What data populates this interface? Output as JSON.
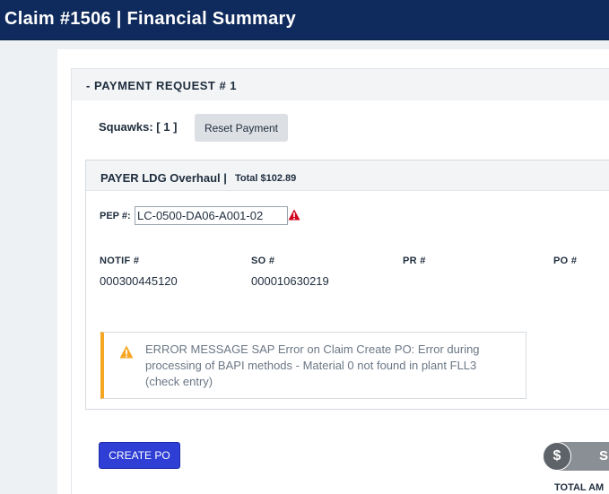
{
  "header": {
    "title": "Claim #1506 | Financial Summary"
  },
  "payment_request": {
    "collapse_symbol": "-",
    "title": "PAYMENT REQUEST # 1",
    "squawks_label": "Squawks: [ 1 ]",
    "reset_button": "Reset Payment"
  },
  "payer": {
    "name": "PAYER LDG Overhaul |",
    "total": "Total $102.89",
    "pep_label": "PEP #:",
    "pep_value": "LC-0500-DA06-A001-02",
    "columns": [
      {
        "label": "NOTIF #",
        "value": "000300445120"
      },
      {
        "label": "SO #",
        "value": "000010630219"
      },
      {
        "label": "PR #",
        "value": ""
      },
      {
        "label": "PO #",
        "value": ""
      }
    ],
    "error_message": "ERROR MESSAGE SAP Error on Claim Create PO: Error during processing of BAPI methods - Material 0 not found in plant FLL3 (check entry)"
  },
  "actions": {
    "create_po": "CREATE PO",
    "status_symbol": "$",
    "status_letter": "S",
    "total_amount_label": "TOTAL AM"
  },
  "colors": {
    "topbar": "#0f2a5c",
    "create_po": "#2f3fd6",
    "warning_orange": "#f5a623",
    "error_red": "#d0021b"
  },
  "icons": {
    "pep_warning": "warning-triangle-red-icon",
    "error_warning": "warning-triangle-orange-icon",
    "status": "dollar-coin-icon"
  }
}
